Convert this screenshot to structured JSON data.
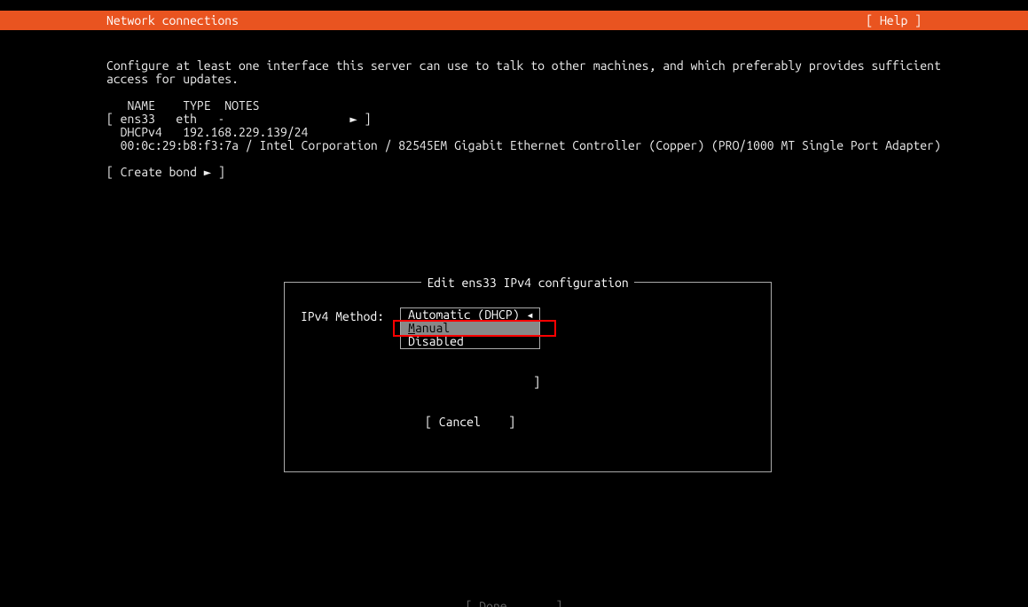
{
  "header": {
    "title": "Network connections",
    "help": "[ Help ]"
  },
  "description": "Configure at least one interface this server can use to talk to other machines, and which preferably provides sufficient\naccess for updates.",
  "table": {
    "header": "   NAME    TYPE  NOTES",
    "row": "[ ens33   eth   -                  ► ]",
    "dhcp_line": "  DHCPv4   192.168.229.139/24",
    "hw_line": "  00:0c:29:b8:f3:7a / Intel Corporation / 82545EM Gigabit Ethernet Controller (Copper) (PRO/1000 MT Single Port Adapter)"
  },
  "create_bond": "[ Create bond ► ]",
  "dialog": {
    "title": " Edit ens33 IPv4 configuration ",
    "method_label": "IPv4 Method:",
    "options": {
      "automatic": "Automatic (DHCP) ◂",
      "manual": "anual",
      "manual_underline": "M",
      "disabled": "Disabled"
    },
    "save_bracket": "        ]",
    "cancel": "[ Cancel    ]"
  },
  "bottom": "[ Done       ]"
}
